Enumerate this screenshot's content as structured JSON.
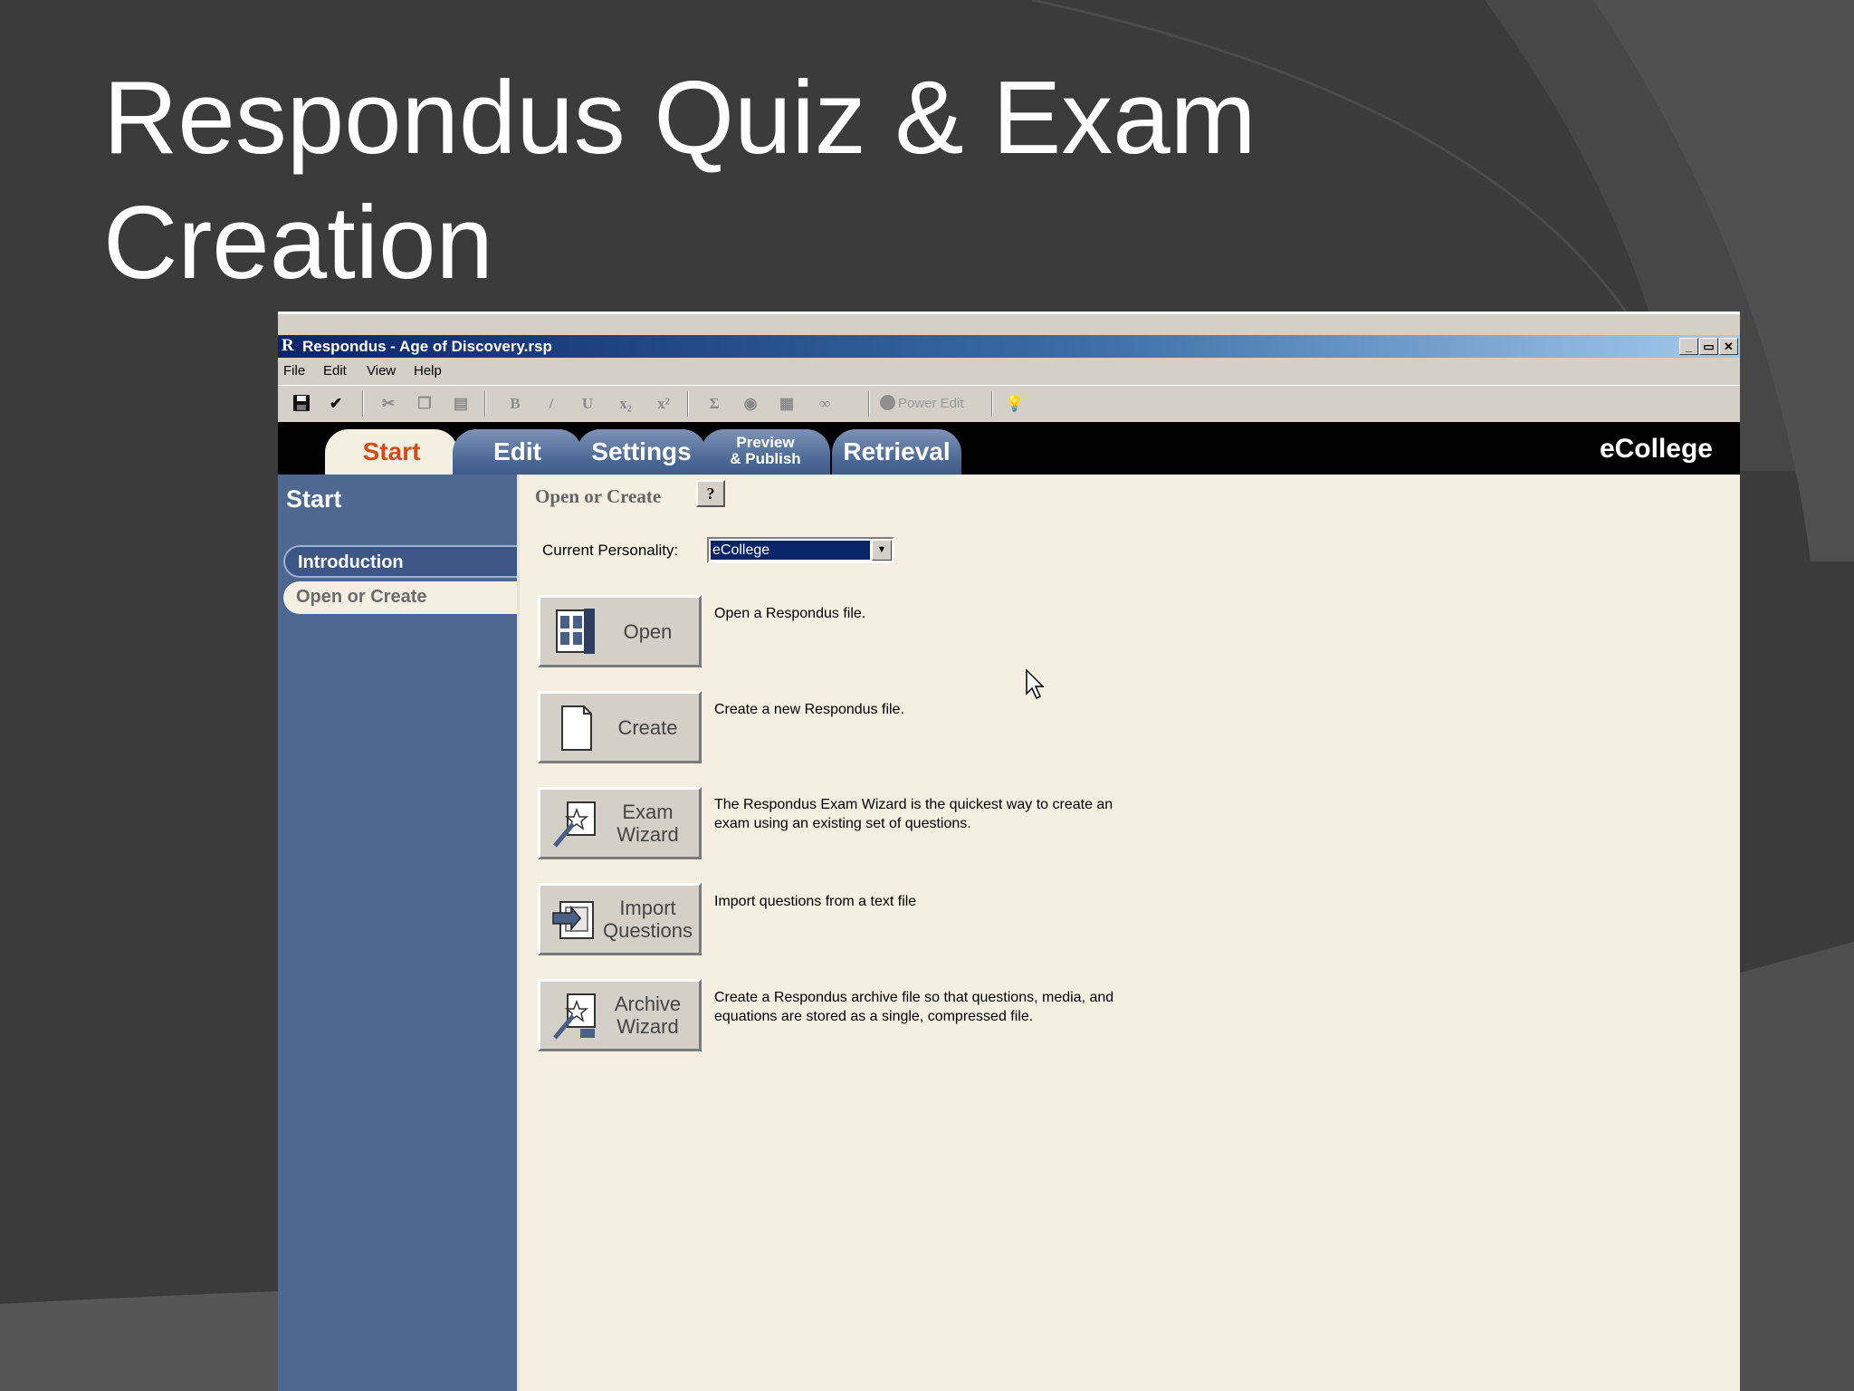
{
  "slide": {
    "title": "Respondus Quiz & Exam Creation"
  },
  "window": {
    "title": "Respondus - Age of Discovery.rsp",
    "controls": [
      "_",
      "▭",
      "✕"
    ]
  },
  "menubar": [
    "File",
    "Edit",
    "View",
    "Help"
  ],
  "toolbar": {
    "power_edit_label": "Power Edit"
  },
  "tabs": [
    {
      "label": "Start",
      "active": true
    },
    {
      "label": "Edit",
      "active": false
    },
    {
      "label": "Settings",
      "active": false
    },
    {
      "label_line1": "Preview",
      "label_line2": "& Publish",
      "active": false
    },
    {
      "label": "Retrieval",
      "active": false
    }
  ],
  "brand": "eCollege",
  "sidebar": {
    "title": "Start",
    "items": [
      {
        "label": "Introduction",
        "selected": false
      },
      {
        "label": "Open or Create",
        "selected": true
      }
    ]
  },
  "main": {
    "section_title": "Open or Create",
    "help_label": "?",
    "personality_label": "Current Personality:",
    "personality_value": "eCollege",
    "actions": [
      {
        "label": "Open",
        "icon": "open-file-icon",
        "description": "Open a Respondus file."
      },
      {
        "label": "Create",
        "icon": "new-file-icon",
        "description": "Create a new Respondus file."
      },
      {
        "label_line1": "Exam",
        "label_line2": "Wizard",
        "icon": "wizard-icon",
        "description": "The Respondus Exam Wizard is the quickest way to create an exam using an existing set of questions."
      },
      {
        "label_line1": "Import",
        "label_line2": "Questions",
        "icon": "import-icon",
        "description": "Import questions from a text file"
      },
      {
        "label_line1": "Archive",
        "label_line2": "Wizard",
        "icon": "archive-wizard-icon",
        "description": "Create a Respondus archive file so that questions, media, and equations are stored as a single, compressed file."
      }
    ]
  },
  "colors": {
    "slide_bg": "#3d3d3e",
    "sidebar": "#4e6892",
    "content": "#f5efe2",
    "active_tab_text": "#d14c17",
    "titlebar": "#0a246a"
  }
}
